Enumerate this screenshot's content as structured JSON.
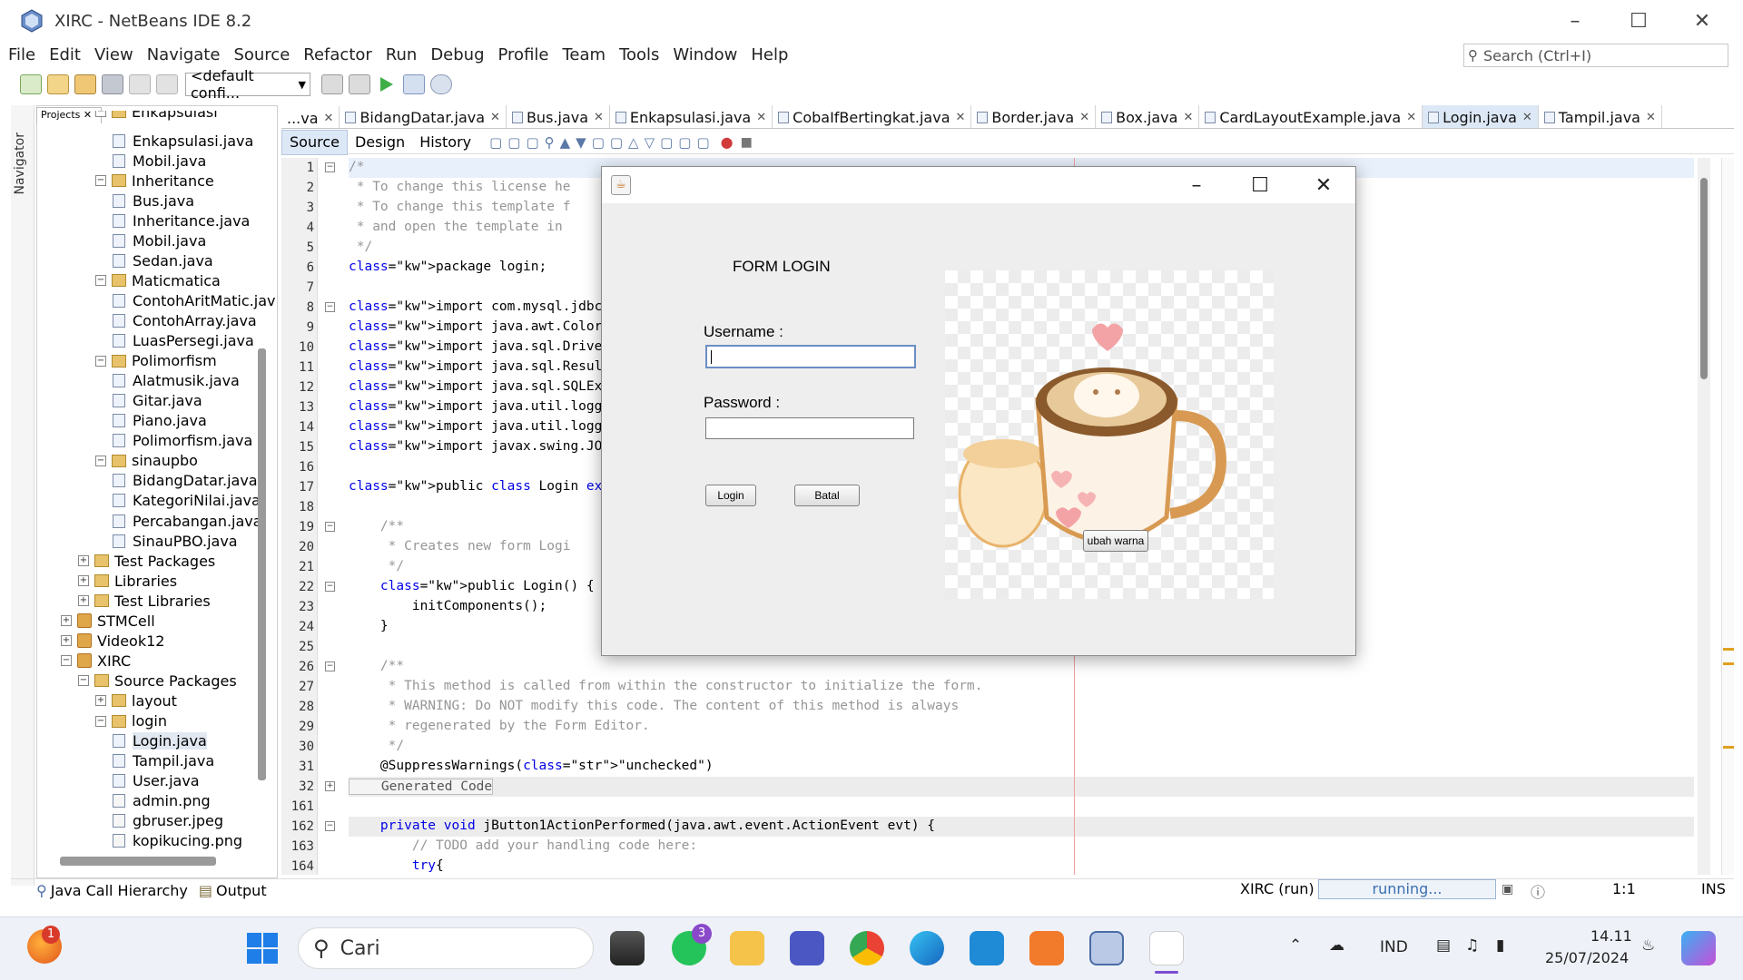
{
  "window": {
    "title": "XIRC - NetBeans IDE 8.2"
  },
  "menu": [
    "File",
    "Edit",
    "View",
    "Navigate",
    "Source",
    "Refactor",
    "Run",
    "Debug",
    "Profile",
    "Team",
    "Tools",
    "Window",
    "Help"
  ],
  "search": {
    "placeholder": "Search (Ctrl+I)"
  },
  "toolbar": {
    "config": "<default confi..."
  },
  "left": {
    "navigator_label": "Navigator",
    "projects_tab": "Projects"
  },
  "tree": [
    {
      "label": "Enkapsulasi",
      "depth": 3,
      "kind": "pkg"
    },
    {
      "label": "Enkapsulasi.java",
      "depth": 4,
      "kind": "java"
    },
    {
      "label": "Mobil.java",
      "depth": 4,
      "kind": "java"
    },
    {
      "label": "Inheritance",
      "depth": 3,
      "kind": "pkg"
    },
    {
      "label": "Bus.java",
      "depth": 4,
      "kind": "java"
    },
    {
      "label": "Inheritance.java",
      "depth": 4,
      "kind": "java"
    },
    {
      "label": "Mobil.java",
      "depth": 4,
      "kind": "java"
    },
    {
      "label": "Sedan.java",
      "depth": 4,
      "kind": "java"
    },
    {
      "label": "Maticmatica",
      "depth": 3,
      "kind": "pkg"
    },
    {
      "label": "ContohAritMatic.jav",
      "depth": 4,
      "kind": "java"
    },
    {
      "label": "ContohArray.java",
      "depth": 4,
      "kind": "java"
    },
    {
      "label": "LuasPersegi.java",
      "depth": 4,
      "kind": "java"
    },
    {
      "label": "Polimorfism",
      "depth": 3,
      "kind": "pkg"
    },
    {
      "label": "Alatmusik.java",
      "depth": 4,
      "kind": "java"
    },
    {
      "label": "Gitar.java",
      "depth": 4,
      "kind": "java"
    },
    {
      "label": "Piano.java",
      "depth": 4,
      "kind": "java"
    },
    {
      "label": "Polimorfism.java",
      "depth": 4,
      "kind": "java"
    },
    {
      "label": "sinaupbo",
      "depth": 3,
      "kind": "pkg"
    },
    {
      "label": "BidangDatar.java",
      "depth": 4,
      "kind": "java"
    },
    {
      "label": "KategoriNilai.java",
      "depth": 4,
      "kind": "java"
    },
    {
      "label": "Percabangan.java",
      "depth": 4,
      "kind": "java"
    },
    {
      "label": "SinauPBO.java",
      "depth": 4,
      "kind": "java"
    },
    {
      "label": "Test Packages",
      "depth": 2,
      "kind": "folder"
    },
    {
      "label": "Libraries",
      "depth": 2,
      "kind": "folder"
    },
    {
      "label": "Test Libraries",
      "depth": 2,
      "kind": "folder"
    },
    {
      "label": "STMCell",
      "depth": 1,
      "kind": "project"
    },
    {
      "label": "Videok12",
      "depth": 1,
      "kind": "project"
    },
    {
      "label": "XIRC",
      "depth": 1,
      "kind": "project"
    },
    {
      "label": "Source Packages",
      "depth": 2,
      "kind": "folder"
    },
    {
      "label": "layout",
      "depth": 3,
      "kind": "pkg"
    },
    {
      "label": "login",
      "depth": 3,
      "kind": "pkg"
    },
    {
      "label": "Login.java",
      "depth": 4,
      "kind": "java"
    },
    {
      "label": "Tampil.java",
      "depth": 4,
      "kind": "java"
    },
    {
      "label": "User.java",
      "depth": 4,
      "kind": "java"
    },
    {
      "label": "admin.png",
      "depth": 4,
      "kind": "file"
    },
    {
      "label": "gbruser.jpeg",
      "depth": 4,
      "kind": "file"
    },
    {
      "label": "kopikucing.png",
      "depth": 4,
      "kind": "file"
    }
  ],
  "editor_tabs": [
    "...va",
    "BidangDatar.java",
    "Bus.java",
    "Enkapsulasi.java",
    "CobaIfBertingkat.java",
    "Border.java",
    "Box.java",
    "CardLayoutExample.java",
    "Login.java",
    "Tampil.java"
  ],
  "active_tab": "Login.java",
  "subtabs": [
    "Source",
    "Design",
    "History"
  ],
  "code": [
    {
      "n": "1",
      "t": "/*",
      "c": "cm"
    },
    {
      "n": "2",
      "t": " * To change this license he",
      "c": "cm"
    },
    {
      "n": "3",
      "t": " * To change this template f",
      "c": "cm"
    },
    {
      "n": "4",
      "t": " * and open the template in",
      "c": "cm"
    },
    {
      "n": "5",
      "t": " */",
      "c": "cm"
    },
    {
      "n": "6",
      "t": "package login;",
      "c": "kw1"
    },
    {
      "n": "7",
      "t": "",
      "c": ""
    },
    {
      "n": "8",
      "t": "import com.mysql.jdbc.Connec",
      "c": "kw1"
    },
    {
      "n": "9",
      "t": "import java.awt.Color;",
      "c": "kw1"
    },
    {
      "n": "10",
      "t": "import java.sql.DriverManage",
      "c": "kw1"
    },
    {
      "n": "11",
      "t": "import java.sql.ResultSet;",
      "c": "kw1"
    },
    {
      "n": "12",
      "t": "import java.sql.SQLException",
      "c": "kw1"
    },
    {
      "n": "13",
      "t": "import java.util.logging.Lev",
      "c": "kw1"
    },
    {
      "n": "14",
      "t": "import java.util.logging.Log",
      "c": "kw1"
    },
    {
      "n": "15",
      "t": "import javax.swing.JOptionPa",
      "c": "kw1"
    },
    {
      "n": "16",
      "t": "",
      "c": ""
    },
    {
      "n": "17",
      "t": "public class Login extends j",
      "c": "cls"
    },
    {
      "n": "18",
      "t": "",
      "c": ""
    },
    {
      "n": "19",
      "t": "    /**",
      "c": "cm"
    },
    {
      "n": "20",
      "t": "     * Creates new form Logi",
      "c": "cm"
    },
    {
      "n": "21",
      "t": "     */",
      "c": "cm"
    },
    {
      "n": "22",
      "t": "    public Login() {",
      "c": "ctor"
    },
    {
      "n": "23",
      "t": "        initComponents();",
      "c": ""
    },
    {
      "n": "24",
      "t": "    }",
      "c": ""
    },
    {
      "n": "25",
      "t": "",
      "c": ""
    },
    {
      "n": "26",
      "t": "    /**",
      "c": "cm"
    },
    {
      "n": "27",
      "t": "     * This method is called from within the constructor to initialize the form.",
      "c": "cm"
    },
    {
      "n": "28",
      "t": "     * WARNING: Do NOT modify this code. The content of this method is always",
      "c": "cm"
    },
    {
      "n": "29",
      "t": "     * regenerated by the Form Editor.",
      "c": "cm"
    },
    {
      "n": "30",
      "t": "     */",
      "c": "cm"
    },
    {
      "n": "31",
      "t": "    @SuppressWarnings(\"unchecked\")",
      "c": "ann"
    },
    {
      "n": "32",
      "t": "    Generated Code",
      "c": "gen"
    },
    {
      "n": "161",
      "t": "",
      "c": ""
    },
    {
      "n": "162",
      "t": "    private void jButton1ActionPerformed(java.awt.event.ActionEvent evt) {",
      "c": "meth"
    },
    {
      "n": "163",
      "t": "        // TODO add your handling code here:",
      "c": "cm"
    },
    {
      "n": "164",
      "t": "        try{",
      "c": "kw1"
    }
  ],
  "dialog": {
    "form_title": "FORM LOGIN",
    "username_label": "Username  :",
    "password_label": "Password  :",
    "username_value": "",
    "password_value": "",
    "login_button": "Login",
    "cancel_button": "Batal",
    "color_button": "ubah warna"
  },
  "status": {
    "call_hierarchy": "Java Call Hierarchy",
    "output": "Output",
    "run": "XIRC (run)",
    "progress": "running...",
    "position": "1:1",
    "mode": "INS"
  },
  "taskbar": {
    "search": "Cari",
    "lang": "IND",
    "time": "14.11",
    "date": "25/07/2024",
    "badge_firefox": "1",
    "badge_whatsapp": "3"
  }
}
